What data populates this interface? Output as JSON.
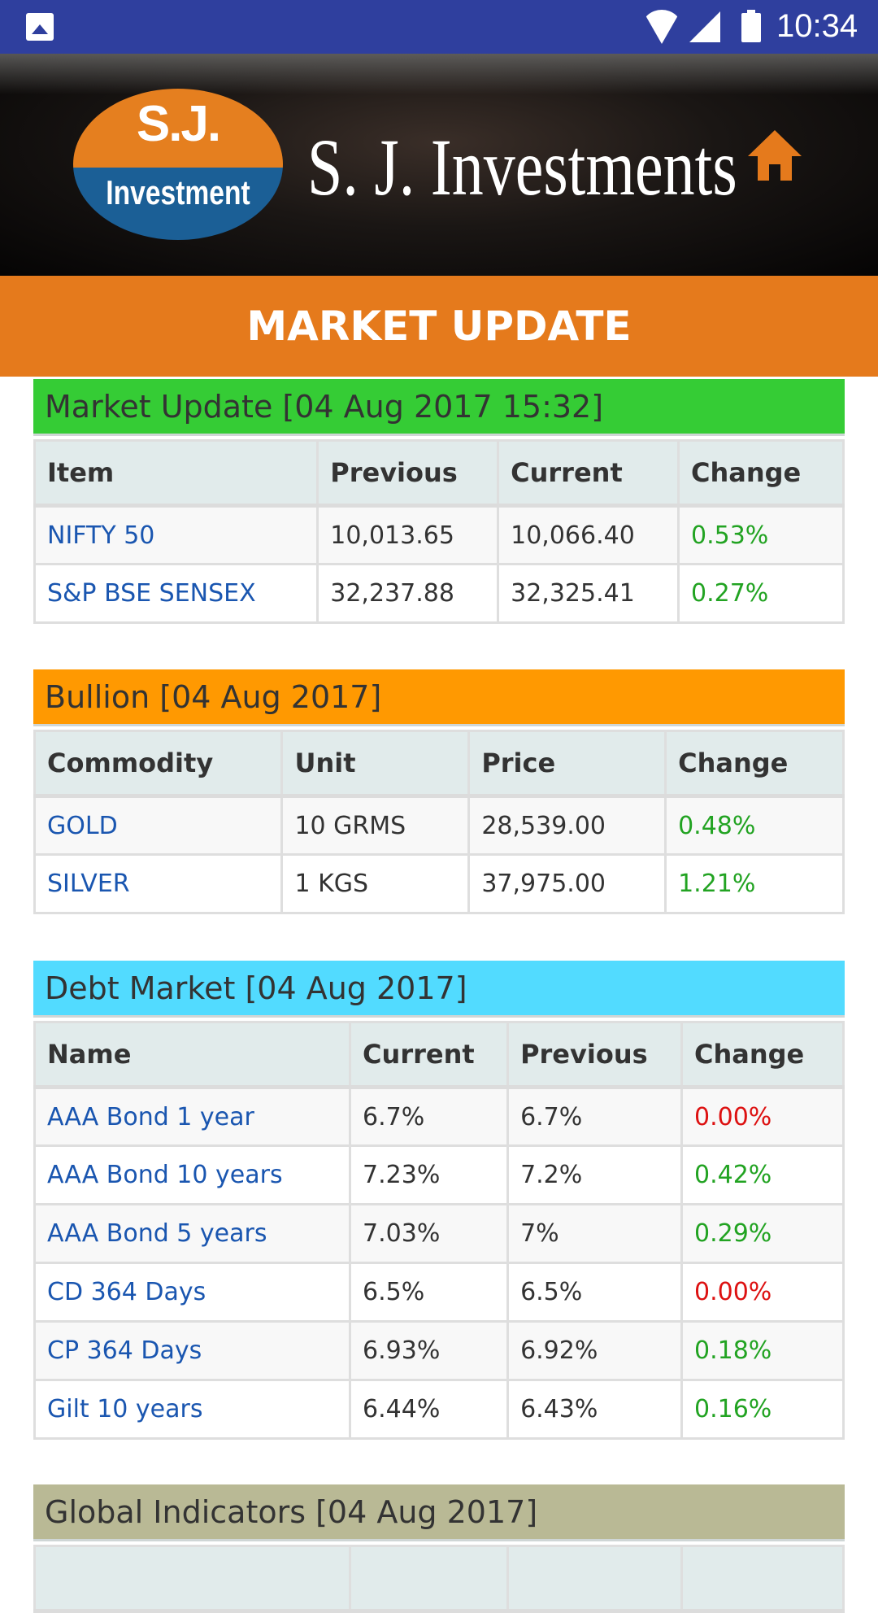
{
  "status_bar": {
    "time": "10:34",
    "icons": [
      "image-icon",
      "wifi-icon",
      "signal-icon",
      "battery-icon"
    ]
  },
  "banner": {
    "logo_top": "S.J.",
    "logo_bottom": "Investment",
    "brand_name": "S. J. Investments",
    "home_icon": "home-icon"
  },
  "page_title": "MARKET UPDATE",
  "colors": {
    "status_bar": "#2f3f9e",
    "title_bar": "#e57a1c",
    "market_header": "#35cc35",
    "bullion_header": "#ff9901",
    "debt_header": "#52dbff",
    "global_header": "#b9b995",
    "link": "#1a56b0",
    "positive": "#22a322",
    "zero": "#dd1111"
  },
  "market": {
    "title": "Market Update [04 Aug 2017 15:32]",
    "columns": [
      "Item",
      "Previous",
      "Current",
      "Change"
    ],
    "rows": [
      {
        "item": "NIFTY 50",
        "previous": "10,013.65",
        "current": "10,066.40",
        "change": "0.53%"
      },
      {
        "item": "S&P BSE SENSEX",
        "previous": "32,237.88",
        "current": "32,325.41",
        "change": "0.27%"
      }
    ]
  },
  "bullion": {
    "title": "Bullion [04 Aug 2017]",
    "columns": [
      "Commodity",
      "Unit",
      "Price",
      "Change"
    ],
    "rows": [
      {
        "commodity": "GOLD",
        "unit": "10 GRMS",
        "price": "28,539.00",
        "change": "0.48%"
      },
      {
        "commodity": "SILVER",
        "unit": "1 KGS",
        "price": "37,975.00",
        "change": "1.21%"
      }
    ]
  },
  "debt": {
    "title": "Debt Market [04 Aug 2017]",
    "columns": [
      "Name",
      "Current",
      "Previous",
      "Change"
    ],
    "rows": [
      {
        "name": "AAA Bond 1 year",
        "current": "6.7%",
        "previous": "6.7%",
        "change": "0.00%"
      },
      {
        "name": "AAA Bond 10 years",
        "current": "7.23%",
        "previous": "7.2%",
        "change": "0.42%"
      },
      {
        "name": "AAA Bond 5 years",
        "current": "7.03%",
        "previous": "7%",
        "change": "0.29%"
      },
      {
        "name": "CD 364 Days",
        "current": "6.5%",
        "previous": "6.5%",
        "change": "0.00%"
      },
      {
        "name": "CP 364 Days",
        "current": "6.93%",
        "previous": "6.92%",
        "change": "0.18%"
      },
      {
        "name": "Gilt 10 years",
        "current": "6.44%",
        "previous": "6.43%",
        "change": "0.16%"
      }
    ]
  },
  "global": {
    "title": "Global Indicators [04 Aug 2017]"
  }
}
